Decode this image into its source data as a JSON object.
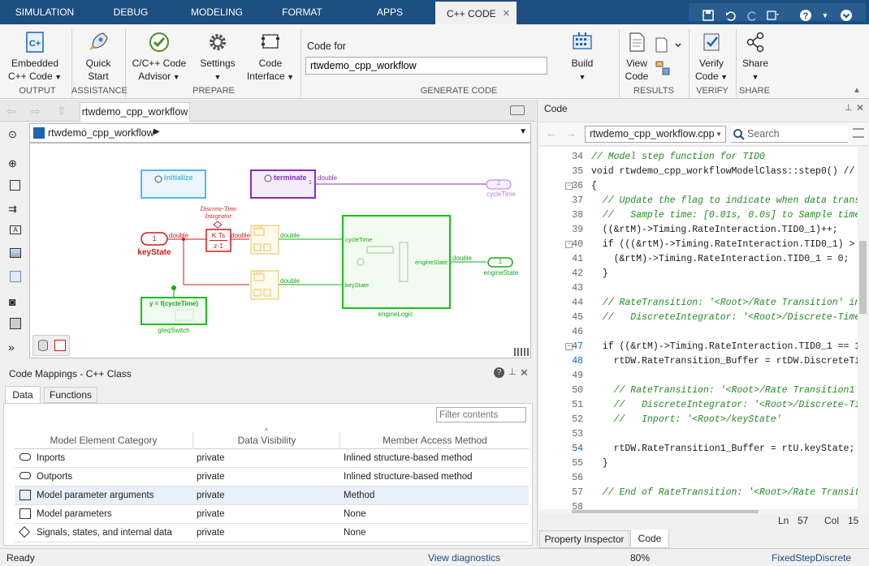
{
  "menu": {
    "tabs": [
      "SIMULATION",
      "DEBUG",
      "MODELING",
      "FORMAT",
      "APPS",
      "C++ CODE"
    ],
    "active_tab": "C++ CODE",
    "close": "✕"
  },
  "ribbon": {
    "embedded": "Embedded\nC++ Code",
    "quick_start": "Quick\nStart",
    "advisor": "C/C++ Code\nAdvisor",
    "settings": "Settings",
    "code_interface": "Code\nInterface",
    "code_for_label": "Code for",
    "code_for_value": "rtwdemo_cpp_workflow",
    "build": "Build",
    "view_code": "View\nCode",
    "verify_code": "Verify\nCode",
    "share": "Share",
    "groups": [
      "OUTPUT",
      "ASSISTANCE",
      "PREPARE",
      "GENERATE CODE",
      "RESULTS",
      "VERIFY",
      "SHARE"
    ]
  },
  "model": {
    "tab": "rtwdemo_cpp_workflow",
    "breadcrumb": "rtwdemo_cpp_workflow",
    "blocks": {
      "initialize": "initialize",
      "terminate": "terminate",
      "term_out": "1",
      "double1": "double",
      "cycletime_port": "2",
      "cycletime_label": "cycleTime",
      "integrator_title": "Discrete-Time\nIntegrator",
      "integrator_k": "K Ts",
      "integrator_z": "z-1",
      "keystate_port": "1",
      "keystate_label": "keyState",
      "double2": "double",
      "double3": "double",
      "double4": "double",
      "double5": "double",
      "double6": "double",
      "engine_cycle": "cycleTime",
      "engine_key": "keyState",
      "engine_state": "engineState",
      "engine_name": "engineLogic",
      "engine_out_port": "1",
      "engine_out_label": "engineState",
      "fcn_label": "y = f(cycleTime)",
      "fcn_name": "gteqSwitch",
      "zoh": "ZOH"
    }
  },
  "mappings": {
    "title": "Code Mappings - C++ Class",
    "tabs": [
      "Data",
      "Functions"
    ],
    "filter_placeholder": "Filter contents",
    "headers": [
      "Model Element Category",
      "Data Visibility",
      "Member Access Method"
    ],
    "rows": [
      {
        "category": "Inports",
        "visibility": "private",
        "method": "Inlined structure-based method"
      },
      {
        "category": "Outports",
        "visibility": "private",
        "method": "Inlined structure-based method"
      },
      {
        "category": "Model parameter arguments",
        "visibility": "private",
        "method": "Method"
      },
      {
        "category": "Model parameters",
        "visibility": "private",
        "method": "None"
      },
      {
        "category": "Signals, states, and internal data",
        "visibility": "private",
        "method": "None"
      }
    ]
  },
  "code": {
    "title": "Code",
    "file": "rtwdemo_cpp_workflow.cpp",
    "search_placeholder": "Search",
    "lines": [
      {
        "n": "34",
        "t": "// Model step function for TID0",
        "c": true
      },
      {
        "n": "35",
        "t": "void rtwdemo_cpp_workflowModelClass::step0() // Sample t",
        "c": false
      },
      {
        "n": "36",
        "t": "{",
        "c": false
      },
      {
        "n": "37",
        "t": "  // Update the flag to indicate when data transfers fro",
        "c": true
      },
      {
        "n": "38",
        "t": "  //   Sample time: [0.01s, 0.0s] to Sample time: [0.1s,",
        "c": true
      },
      {
        "n": "39",
        "t": "  ((&rtM)->Timing.RateInteraction.TID0_1)++;",
        "c": false
      },
      {
        "n": "40",
        "t": "  if (((&rtM)->Timing.RateInteraction.TID0_1) > 9) {",
        "c": false
      },
      {
        "n": "41",
        "t": "    (&rtM)->Timing.RateInteraction.TID0_1 = 0;",
        "c": false
      },
      {
        "n": "42",
        "t": "  }",
        "c": false
      },
      {
        "n": "43",
        "t": "",
        "c": false
      },
      {
        "n": "44",
        "t": "  // RateTransition: '<Root>/Rate Transition' incorporat",
        "c": true
      },
      {
        "n": "45",
        "t": "  //   DiscreteIntegrator: '<Root>/Discrete-Time Integra",
        "c": true
      },
      {
        "n": "46",
        "t": "",
        "c": false
      },
      {
        "n": "47",
        "t": "  if ((&rtM)->Timing.RateInteraction.TID0_1 == 1) {",
        "c": false
      },
      {
        "n": "48",
        "t": "    rtDW.RateTransition_Buffer = rtDW.DiscreteTimeIntegr",
        "c": false
      },
      {
        "n": "49",
        "t": "",
        "c": false
      },
      {
        "n": "50",
        "t": "    // RateTransition: '<Root>/Rate Transition1' incorpo",
        "c": true
      },
      {
        "n": "51",
        "t": "    //   DiscreteIntegrator: '<Root>/Discrete-Time Integ",
        "c": true
      },
      {
        "n": "52",
        "t": "    //   Inport: '<Root>/keyState'",
        "c": true
      },
      {
        "n": "53",
        "t": "",
        "c": false
      },
      {
        "n": "54",
        "t": "    rtDW.RateTransition1_Buffer = rtU.keyState;",
        "c": false
      },
      {
        "n": "55",
        "t": "  }",
        "c": false
      },
      {
        "n": "56",
        "t": "",
        "c": false
      },
      {
        "n": "57",
        "t": "  // End of RateTransition: '<Root>/Rate Transition'",
        "c": true
      },
      {
        "n": "58",
        "t": "",
        "c": false
      }
    ],
    "ln_label": "Ln",
    "ln_value": "57",
    "col_label": "Col",
    "col_value": "15",
    "bottom_tabs": [
      "Property Inspector",
      "Code"
    ]
  },
  "status": {
    "ready": "Ready",
    "diagnostics": "View diagnostics",
    "zoom": "80%",
    "solver": "FixedStepDiscrete"
  }
}
